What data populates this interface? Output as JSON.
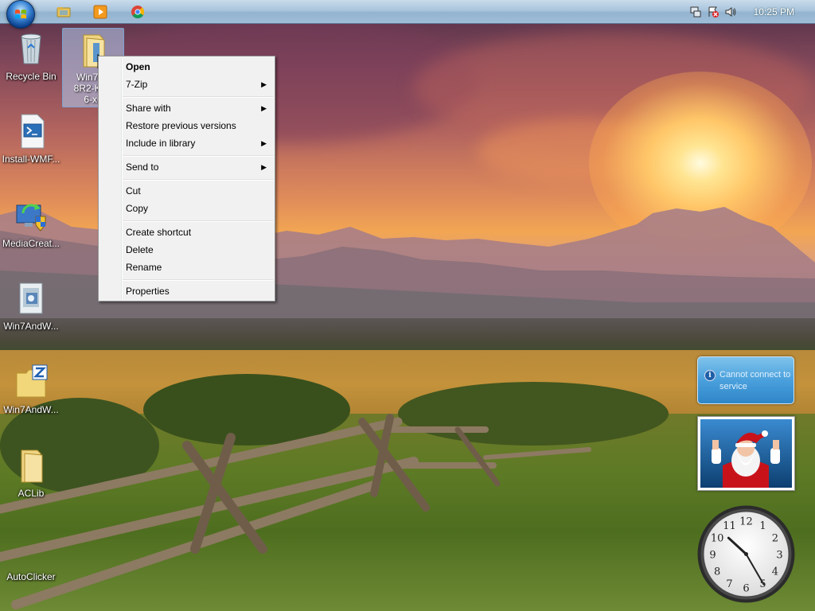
{
  "taskbar": {
    "clock_time": "10:25 PM",
    "pinned": [
      {
        "name": "explorer-icon"
      },
      {
        "name": "media-player-icon"
      },
      {
        "name": "chrome-icon"
      }
    ],
    "tray_icons": [
      "network-icon",
      "action-center-icon",
      "volume-icon"
    ]
  },
  "desktop": {
    "icons": [
      {
        "label": "Recycle Bin",
        "icon": "recycle-bin-icon"
      },
      {
        "label": "Install-WMF...",
        "icon": "powershell-script-icon"
      },
      {
        "label": "MediaCreat...",
        "icon": "media-creation-tool-icon"
      },
      {
        "label": "Win7AndW...",
        "icon": "installer-icon"
      },
      {
        "label": "Win7AndW...",
        "icon": "zip-folder-icon"
      },
      {
        "label": "ACLib",
        "icon": "folder-icon"
      },
      {
        "label": "AutoClicker",
        "icon": "application-icon"
      }
    ],
    "selected_icon": {
      "label_line1": "Win7An",
      "label_line2": "8R2-KB3",
      "label_line3": "6-x6",
      "icon": "folder-icon"
    }
  },
  "context_menu": {
    "items": [
      {
        "label": "Open",
        "bold": true,
        "submenu": false
      },
      {
        "label": "7-Zip",
        "submenu": true
      },
      {
        "label": "Share with",
        "submenu": true
      },
      {
        "label": "Restore previous versions",
        "submenu": false
      },
      {
        "label": "Include in library",
        "submenu": true
      },
      {
        "label": "Send to",
        "submenu": true
      },
      {
        "label": "Cut",
        "submenu": false
      },
      {
        "label": "Copy",
        "submenu": false
      },
      {
        "label": "Create shortcut",
        "submenu": false
      },
      {
        "label": "Delete",
        "submenu": false
      },
      {
        "label": "Rename",
        "submenu": false
      },
      {
        "label": "Properties",
        "submenu": false
      }
    ],
    "submenu_arrow": "▶"
  },
  "gadgets": {
    "weather_message": "Cannot connect to service",
    "clock": {
      "hour": 10,
      "minute": 25,
      "numerals": [
        "12",
        "1",
        "2",
        "3",
        "4",
        "5",
        "6",
        "7",
        "8",
        "9",
        "10",
        "11"
      ]
    }
  }
}
